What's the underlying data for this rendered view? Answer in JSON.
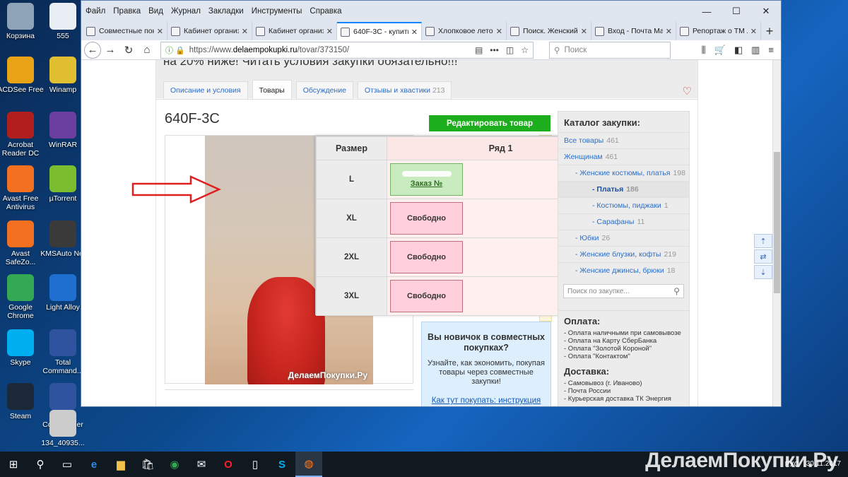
{
  "desktop": {
    "icons": [
      {
        "label": "Корзина",
        "icon": "recycle-bin-icon",
        "color": "#8fa3b8"
      },
      {
        "label": "555",
        "icon": "file-icon",
        "color": "#e9eef4"
      },
      {
        "label": "ACDSee Free",
        "icon": "acdsee-icon",
        "color": "#e8a317"
      },
      {
        "label": "Winamp",
        "icon": "winamp-icon",
        "color": "#e0c030"
      },
      {
        "label": "Acrobat Reader DC",
        "icon": "acrobat-icon",
        "color": "#b01e1e"
      },
      {
        "label": "WinRAR",
        "icon": "winrar-icon",
        "color": "#6b3fa0"
      },
      {
        "label": "Avast Free Antivirus",
        "icon": "avast-icon",
        "color": "#f37021"
      },
      {
        "label": "µTorrent",
        "icon": "utorrent-icon",
        "color": "#7cbc2f"
      },
      {
        "label": "Avast SafeZo...",
        "icon": "avast-safezone-icon",
        "color": "#f37021"
      },
      {
        "label": "KMSAuto Net",
        "icon": "kmsauto-icon",
        "color": "#3a3a3a"
      },
      {
        "label": "Google Chrome",
        "icon": "chrome-icon",
        "color": "#34a853"
      },
      {
        "label": "Light Alloy",
        "icon": "light-alloy-icon",
        "color": "#1e6fd0"
      },
      {
        "label": "Skype",
        "icon": "skype-icon",
        "color": "#00aff0"
      },
      {
        "label": "Total Command...",
        "icon": "floppy-icon",
        "color": "#3053a0"
      },
      {
        "label": "Steam",
        "icon": "steam-icon",
        "color": "#1b2838"
      },
      {
        "label": "Total Commander",
        "icon": "floppy-icon",
        "color": "#3053a0"
      },
      {
        "label": "134_40935...",
        "icon": "image-file-icon",
        "color": "#cccccc"
      }
    ]
  },
  "browser": {
    "menu": [
      "Файл",
      "Правка",
      "Вид",
      "Журнал",
      "Закладки",
      "Инструменты",
      "Справка"
    ],
    "window_controls": {
      "minimize": "—",
      "maximize": "☐",
      "close": "✕"
    },
    "tabs": [
      {
        "title": "Совместные покупки",
        "active": false
      },
      {
        "title": "Кабинет организатора",
        "active": false
      },
      {
        "title": "Кабинет организатора",
        "active": false
      },
      {
        "title": "640F-3C - купить",
        "active": true
      },
      {
        "title": "Хлопковое лето",
        "active": false
      },
      {
        "title": "Поиск. Женский",
        "active": false
      },
      {
        "title": "Вход - Почта Mail",
        "active": false
      },
      {
        "title": "Репортаж о ТМ Л",
        "active": false
      }
    ],
    "new_tab": "+",
    "url_scheme": "https://www.",
    "url_host": "delaempokupki.ru",
    "url_path": "/tovar/373150/",
    "search_placeholder": "Поиск"
  },
  "page": {
    "notice": "на 20% ниже! Читать условия закупки обязательно!!!",
    "tabs": [
      {
        "label": "Описание и условия",
        "count": ""
      },
      {
        "label": "Товары",
        "count": ""
      },
      {
        "label": "Обсуждение",
        "count": ""
      },
      {
        "label": "Отзывы и хвастики",
        "count": "213"
      }
    ],
    "product_title": "640F-3C",
    "edit_button": "Редактировать товар",
    "photo_watermark": "ДелаемПокупки.Ру",
    "size_table": {
      "col_size": "Размер",
      "col_row": "Ряд 1",
      "rows": [
        {
          "size": "L",
          "status": "Заказ №",
          "taken": true
        },
        {
          "size": "XL",
          "status": "Свободно",
          "taken": false
        },
        {
          "size": "2XL",
          "status": "Свободно",
          "taken": false
        },
        {
          "size": "3XL",
          "status": "Свободно",
          "taken": false
        }
      ]
    },
    "promo": {
      "heading": "Вы новичок в совместных покупках?",
      "text": "Узнайте, как экономить, покупая товары через совместные закупки!",
      "link": "Как тут покупать: инструкция"
    },
    "catalog": {
      "title": "Каталог закупки:",
      "items": [
        {
          "label": "Все товары",
          "count": "461",
          "level": 0,
          "bold": false
        },
        {
          "label": "Женщинам",
          "count": "461",
          "level": 0,
          "bold": false
        },
        {
          "label": "- Женские костюмы, платья",
          "count": "198",
          "level": 1,
          "bold": false
        },
        {
          "label": "- Платья",
          "count": "186",
          "level": 2,
          "bold": true
        },
        {
          "label": "- Костюмы, пиджаки",
          "count": "1",
          "level": 2,
          "bold": false
        },
        {
          "label": "- Сарафаны",
          "count": "11",
          "level": 2,
          "bold": false
        },
        {
          "label": "- Юбки",
          "count": "26",
          "level": 1,
          "bold": false
        },
        {
          "label": "- Женские блузки, кофты",
          "count": "219",
          "level": 1,
          "bold": false
        },
        {
          "label": "- Женские джинсы, брюки",
          "count": "18",
          "level": 1,
          "bold": false
        }
      ],
      "search_placeholder": "Поиск по закупке..."
    },
    "payment": {
      "title": "Оплата:",
      "items": [
        "- Оплата наличными при самовывозе",
        "- Оплата на Карту СберБанка",
        "- Оплата \"Золотой Короной\"",
        "- Оплата \"Контактом\""
      ]
    },
    "delivery": {
      "title": "Доставка:",
      "items": [
        "- Самовывоз (г. Иваново)",
        "- Почта России",
        "- Курьерская доставка ТК Энергия"
      ]
    }
  },
  "taskbar": {
    "language": "РУС",
    "time": "",
    "date": "30.11.2017",
    "watermark": "ДелаемПокупки.Ру"
  },
  "colors": {
    "accent": "#0a84ff",
    "edit_button": "#1cae1c",
    "slot_free": "#ffd0dc",
    "slot_taken": "#c8ecc0",
    "arrow": "#e02020"
  }
}
